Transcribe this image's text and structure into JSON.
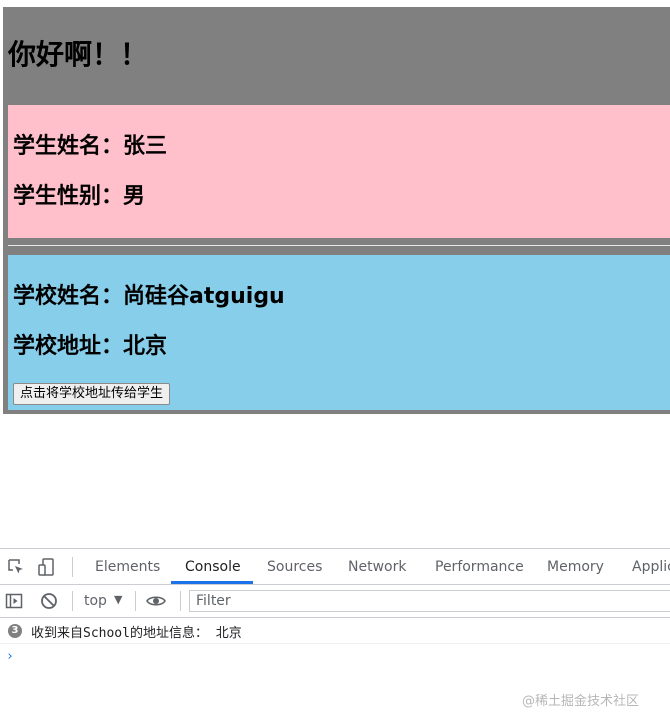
{
  "app": {
    "title": "你好啊！！",
    "student": {
      "name_text": "学生姓名：张三",
      "gender_text": "学生性别：男",
      "bg_color": "#ffc0cb"
    },
    "school": {
      "name_text": "学校姓名：尚硅谷atguigu",
      "address_text": "学校地址：北京",
      "button_label": "点击将学校地址传给学生",
      "bg_color": "#87ceeb"
    },
    "bg_color": "#808080"
  },
  "devtools": {
    "tabs": [
      {
        "label": "Elements",
        "active": false
      },
      {
        "label": "Console",
        "active": true
      },
      {
        "label": "Sources",
        "active": false
      },
      {
        "label": "Network",
        "active": false
      },
      {
        "label": "Performance",
        "active": false
      },
      {
        "label": "Memory",
        "active": false
      },
      {
        "label": "Applic",
        "active": false
      }
    ],
    "icons": [
      "inspect-element-icon",
      "device-toolbar-icon",
      "sidebar-toggle-icon",
      "clear-console-icon",
      "eye-icon"
    ],
    "context": "top",
    "filter_placeholder": "Filter",
    "log": {
      "count": "3",
      "message": "收到来自School的地址信息： 北京"
    },
    "prompt_symbol": "›",
    "accent_color": "#1a73e8"
  },
  "watermark": "@稀土掘金技术社区"
}
